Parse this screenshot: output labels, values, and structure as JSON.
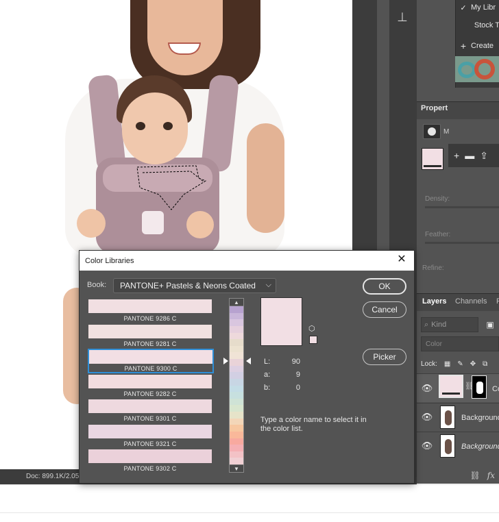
{
  "status": {
    "doc_info": "Doc: 899.1K/2.05..."
  },
  "library_menu": {
    "items": [
      {
        "check": "✓",
        "label": "My Libr"
      },
      {
        "check": "",
        "label": "Stock T"
      },
      {
        "check": "+",
        "label": "Create"
      }
    ]
  },
  "properties": {
    "tab_label": "Propert",
    "mask_sub_label": "M",
    "swatch_color": "#f2dfe4",
    "density_label": "Density:",
    "feather_label": "Feather:",
    "refine_label": "Refine:"
  },
  "layers": {
    "tabs": [
      "Layers",
      "Channels",
      "P"
    ],
    "kind_placeholder": "Kind",
    "blend_mode": "Color",
    "lock_label": "Lock:",
    "rows": [
      {
        "name": "Co",
        "selected": true,
        "italic": false
      },
      {
        "name": "Background",
        "selected": false,
        "italic": false
      },
      {
        "name": "Background",
        "selected": false,
        "italic": true
      }
    ]
  },
  "dialog": {
    "title": "Color Libraries",
    "book_label": "Book:",
    "book_value": "PANTONE+ Pastels & Neons Coated",
    "swatches": [
      {
        "name": "PANTONE 9286 C",
        "color": "#f1dfe2",
        "selected": false
      },
      {
        "name": "PANTONE 9281 C",
        "color": "#f1e1e0",
        "selected": false
      },
      {
        "name": "PANTONE 9300 C",
        "color": "#f2dfe4",
        "selected": true
      },
      {
        "name": "PANTONE 9282 C",
        "color": "#f2dcdf",
        "selected": false
      },
      {
        "name": "PANTONE 9301 C",
        "color": "#eed9df",
        "selected": false
      },
      {
        "name": "PANTONE 9321 C",
        "color": "#ead6e2",
        "selected": false
      },
      {
        "name": "PANTONE 9302 C",
        "color": "#ebd1da",
        "selected": false
      }
    ],
    "spectrum_colors": [
      "#b7a2cf",
      "#c9b6d9",
      "#d9c6df",
      "#e6d0dd",
      "#eed9dc",
      "#e6dccb",
      "#ece2d0",
      "#f0e3d6",
      "#e9d3d8",
      "#ddd0e2",
      "#d2cfe3",
      "#c8d6e4",
      "#c4dde6",
      "#c7e0df",
      "#cfe3d6",
      "#d8e6cf",
      "#e6e3c9",
      "#f3d6b8",
      "#f7c7a0",
      "#f9b89a",
      "#f8a99f",
      "#f5b0b4",
      "#f3c2c6",
      "#f0d0d4"
    ],
    "preview_color": "#f2dfe4",
    "lab": [
      {
        "label": "L:",
        "value": "90"
      },
      {
        "label": "a:",
        "value": "9"
      },
      {
        "label": "b:",
        "value": "0"
      }
    ],
    "hint": "Type a color name to select it in the color list.",
    "buttons": {
      "ok": "OK",
      "cancel": "Cancel",
      "picker": "Picker"
    }
  }
}
